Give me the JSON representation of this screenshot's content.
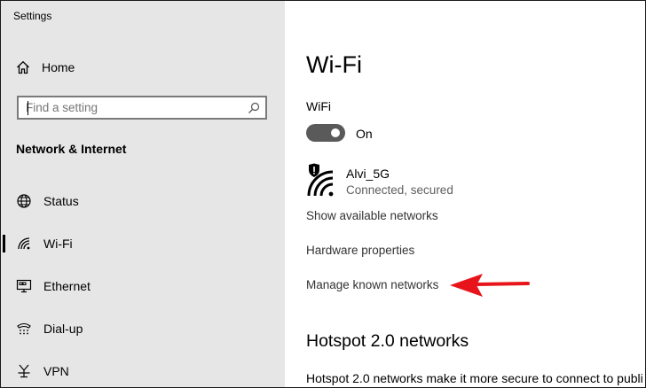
{
  "window": {
    "title": "Settings"
  },
  "sidebar": {
    "home_label": "Home",
    "search": {
      "placeholder": "Find a setting",
      "value": ""
    },
    "section_title": "Network & Internet",
    "items": [
      {
        "label": "Status",
        "icon": "globe-icon",
        "selected": false
      },
      {
        "label": "Wi-Fi",
        "icon": "wifi-icon",
        "selected": true
      },
      {
        "label": "Ethernet",
        "icon": "ethernet-icon",
        "selected": false
      },
      {
        "label": "Dial-up",
        "icon": "dialup-icon",
        "selected": false
      },
      {
        "label": "VPN",
        "icon": "vpn-icon",
        "selected": false
      }
    ]
  },
  "main": {
    "title": "Wi-Fi",
    "wifi_label": "WiFi",
    "toggle_state": "On",
    "network": {
      "name": "Alvi_5G",
      "status": "Connected, secured"
    },
    "links": {
      "show_networks": "Show available networks",
      "hardware": "Hardware properties",
      "manage": "Manage known networks"
    },
    "hotspot_title": "Hotspot 2.0 networks",
    "hotspot_desc": "Hotspot 2.0 networks make it more secure to connect to publi"
  },
  "colors": {
    "sidebar_bg": "#e6e6e6",
    "main_bg": "#ffffff",
    "toggle_on": "#5a5a5a",
    "annotation_arrow": "#e8141b"
  }
}
